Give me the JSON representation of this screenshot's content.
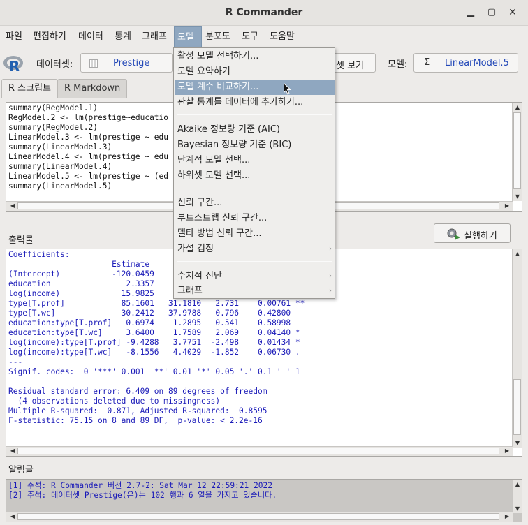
{
  "window": {
    "title": "R Commander"
  },
  "menubar": [
    "파일",
    "편집하기",
    "데이터",
    "통계",
    "그래프",
    "모델",
    "분포도",
    "도구",
    "도움말"
  ],
  "toolbar": {
    "dataset_label": "데이터셋:",
    "dataset_value": "Prestige",
    "view_dataset_label": "셋 보기",
    "model_label": "모델:",
    "model_value": "LinearModel.5"
  },
  "tabs": [
    "R 스크립트",
    "R Markdown"
  ],
  "script_lines": [
    "summary(RegModel.1)",
    "RegModel.2 <- lm(prestige~educatio",
    "summary(RegModel.2)",
    "LinearModel.3 <- lm(prestige ~ edu                     ge)",
    "summary(LinearModel.3)",
    "LinearModel.4 <- lm(prestige ~ edu                     =Prestige)",
    "summary(LinearModel.4)",
    "LinearModel.5 <- lm(prestige ~ (ed                     =Prestige)",
    "summary(LinearModel.5)"
  ],
  "output_label": "출력물",
  "run_button": "실행하기",
  "output_lines": [
    "Coefficients:",
    "                      Estimate",
    "(Intercept)           -120.0459                        ***",
    "education                2.3357                        *",
    "log(income)             15.9825                        ***",
    "type[T.prof]            85.1601   31.1810   2.731    0.00761 **",
    "type[T.wc]              30.2412   37.9788   0.796    0.42800",
    "education:type[T.prof]   0.6974    1.2895   0.541    0.58998",
    "education:type[T.wc]     3.6400    1.7589   2.069    0.04140 *",
    "log(income):type[T.prof] -9.4288   3.7751  -2.498    0.01434 *",
    "log(income):type[T.wc]   -8.1556   4.4029  -1.852    0.06730 .",
    "---",
    "Signif. codes:  0 '***' 0.001 '**' 0.01 '*' 0.05 '.' 0.1 ' ' 1",
    "",
    "Residual standard error: 6.409 on 89 degrees of freedom",
    "  (4 observations deleted due to missingness)",
    "Multiple R-squared:  0.871, Adjusted R-squared:  0.8595",
    "F-statistic: 75.15 on 8 and 89 DF,  p-value: < 2.2e-16"
  ],
  "messages_label": "알림글",
  "message_lines": [
    "[1] 주석: R Commander 버전 2.7-2: Sat Mar 12 22:59:21 2022",
    "[2] 주석: 데이터셋 Prestige(은)는 102 행과 6 열을 가지고 있습니다."
  ],
  "model_menu": {
    "group1": [
      "활성 모델 선택하기...",
      "모델 요약하기",
      "모델 계수 비교하기...",
      "관찰 통계를 데이터에 추가하기..."
    ],
    "group2": [
      "Akaike 정보량 기준 (AIC)",
      "Bayesian 정보량 기준 (BIC)",
      "단계적 모델 선택...",
      "하위셋 모델 선택..."
    ],
    "group3": [
      "신뢰 구간...",
      "부트스트랩 신뢰 구간...",
      "델타 방법 신뢰 구간...",
      "가설 검정"
    ],
    "group4": [
      "수치적 진단",
      "그래프"
    ]
  },
  "colors": {
    "menu_highlight": "#8fa7c0",
    "link_blue": "#2348b8",
    "output_blue": "#1a1ab8",
    "message_bg": "#c9c7c4"
  }
}
